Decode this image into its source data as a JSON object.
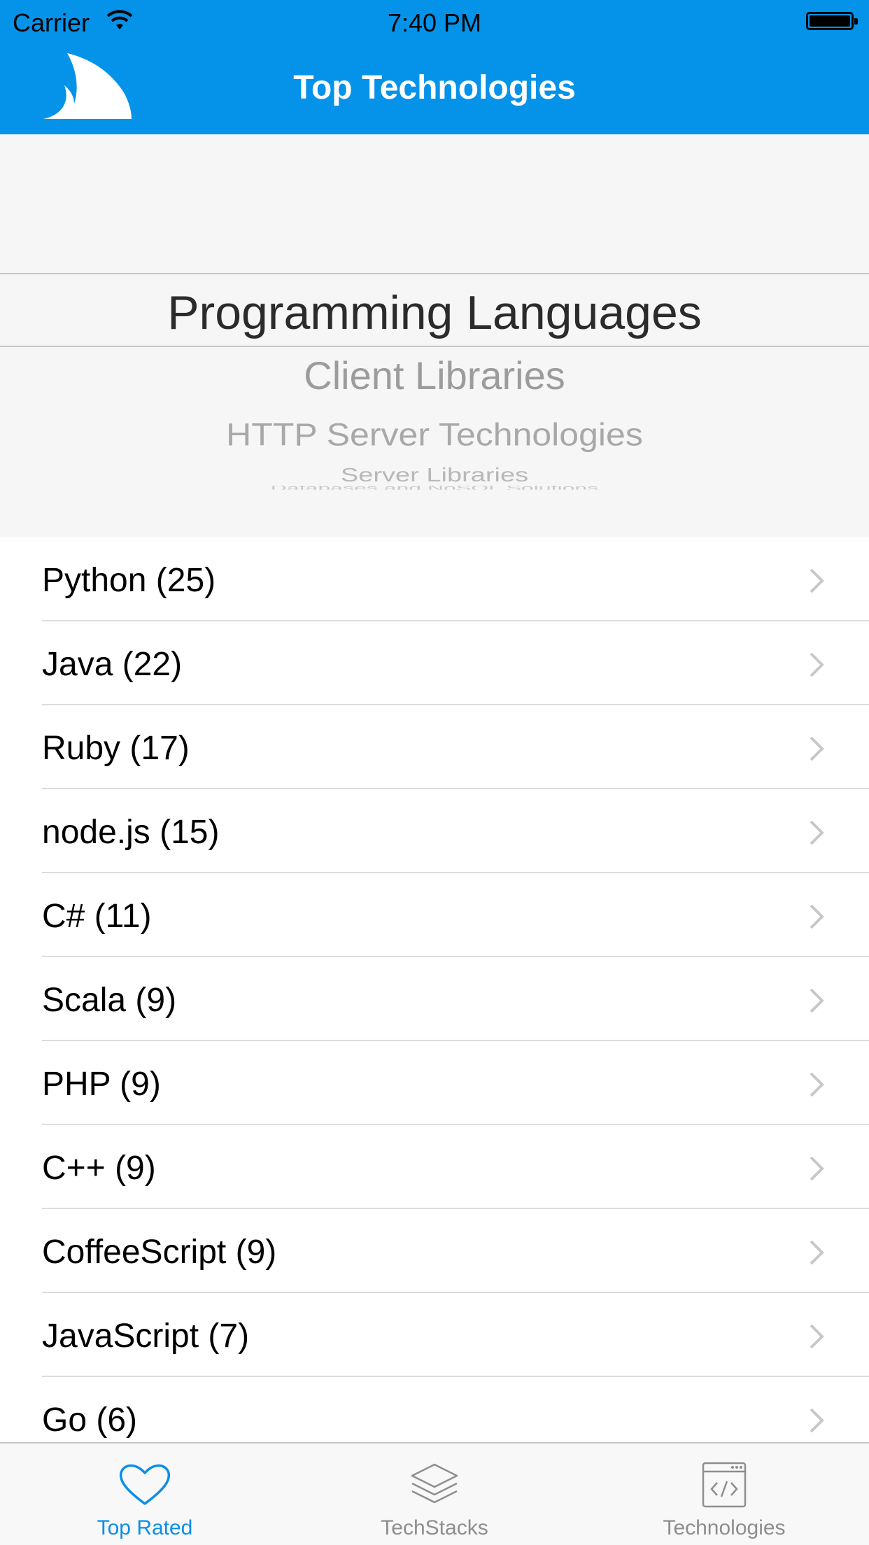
{
  "status_bar": {
    "carrier": "Carrier",
    "time": "7:40 PM"
  },
  "nav": {
    "title": "Top Technologies"
  },
  "picker": {
    "selected": "Programming Languages",
    "options_below": [
      "Client Libraries",
      "HTTP Server Technologies",
      "Server Libraries",
      "Databases and NoSQL Solutions"
    ]
  },
  "list": {
    "rows": [
      {
        "label": "Python (25)"
      },
      {
        "label": "Java (22)"
      },
      {
        "label": "Ruby (17)"
      },
      {
        "label": "node.js (15)"
      },
      {
        "label": "C# (11)"
      },
      {
        "label": "Scala (9)"
      },
      {
        "label": "PHP (9)"
      },
      {
        "label": "C++ (9)"
      },
      {
        "label": "CoffeeScript (9)"
      },
      {
        "label": "JavaScript (7)"
      },
      {
        "label": "Go (6)"
      }
    ]
  },
  "tabbar": {
    "tabs": [
      {
        "label": "Top Rated",
        "icon": "heart-icon",
        "active": true
      },
      {
        "label": "TechStacks",
        "icon": "layers-icon",
        "active": false
      },
      {
        "label": "Technologies",
        "icon": "code-window-icon",
        "active": false
      }
    ]
  },
  "colors": {
    "accent": "#0593ea",
    "tab_active": "#0a8ee8",
    "tab_inactive": "#8e8e8e"
  }
}
